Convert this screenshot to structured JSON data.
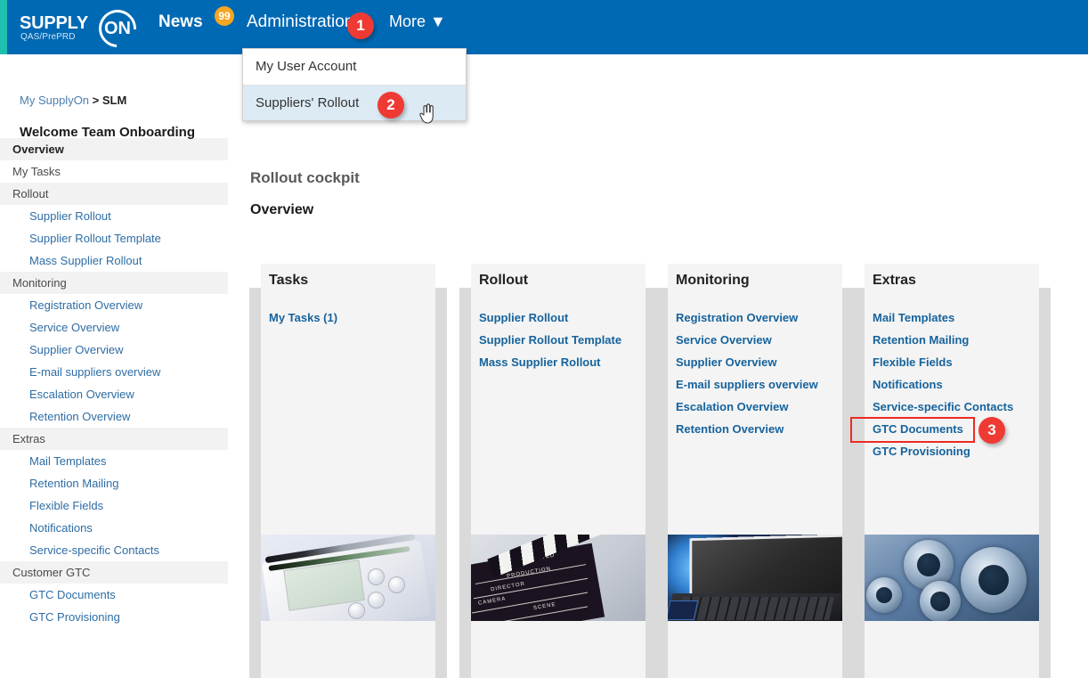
{
  "header": {
    "logo": {
      "word": "SUPPLY",
      "on": "ON",
      "sub": "QAS/PrePRD",
      "brand_color": "#0069b4",
      "accent_color": "#1ec0b0"
    },
    "nav": {
      "news_label": "News",
      "news_badge": "99",
      "news_badge_color": "#f5a623",
      "admin_label": "Administration",
      "more_label": "More ▼"
    }
  },
  "dropdown": {
    "items": [
      {
        "label": "My User Account",
        "active": false
      },
      {
        "label": "Suppliers' Rollout",
        "active": true
      }
    ]
  },
  "annotations": {
    "badge_color": "#ef3a34",
    "highlight_color": "#ee2a22",
    "steps": [
      {
        "number": "1",
        "target": "Administration"
      },
      {
        "number": "2",
        "target": "Suppliers' Rollout"
      },
      {
        "number": "3",
        "target": "GTC Documents"
      }
    ]
  },
  "breadcrumb": {
    "root": "My SupplyOn",
    "separator": ">",
    "current": "SLM"
  },
  "welcome": "Welcome Team Onboarding",
  "sidebar": {
    "items": [
      {
        "type": "group",
        "label": "Overview",
        "bold": true
      },
      {
        "type": "plain",
        "label": "My Tasks"
      },
      {
        "type": "group",
        "label": "Rollout",
        "bold": false
      },
      {
        "type": "link",
        "label": "Supplier Rollout"
      },
      {
        "type": "link",
        "label": "Supplier Rollout Template"
      },
      {
        "type": "link",
        "label": "Mass Supplier Rollout"
      },
      {
        "type": "group",
        "label": "Monitoring",
        "bold": false
      },
      {
        "type": "link",
        "label": "Registration Overview"
      },
      {
        "type": "link",
        "label": "Service Overview"
      },
      {
        "type": "link",
        "label": "Supplier Overview"
      },
      {
        "type": "link",
        "label": "E-mail suppliers overview"
      },
      {
        "type": "link",
        "label": "Escalation Overview"
      },
      {
        "type": "link",
        "label": "Retention Overview"
      },
      {
        "type": "group",
        "label": "Extras",
        "bold": false
      },
      {
        "type": "link",
        "label": "Mail Templates"
      },
      {
        "type": "link",
        "label": "Retention Mailing"
      },
      {
        "type": "link",
        "label": "Flexible Fields"
      },
      {
        "type": "link",
        "label": "Notifications"
      },
      {
        "type": "link",
        "label": "Service-specific Contacts"
      },
      {
        "type": "group",
        "label": "Customer GTC",
        "bold": false
      },
      {
        "type": "link",
        "label": "GTC Documents"
      },
      {
        "type": "link",
        "label": "GTC Provisioning"
      }
    ]
  },
  "main": {
    "title": "Rollout cockpit",
    "subtitle": "Overview",
    "cards": [
      {
        "heading": "Tasks",
        "photo": "pda-organizer-photo",
        "links": [
          "My Tasks (1)"
        ]
      },
      {
        "heading": "Rollout",
        "photo": "clapperboard-photo",
        "links": [
          "Supplier Rollout",
          "Supplier Rollout Template",
          "Mass Supplier Rollout"
        ]
      },
      {
        "heading": "Monitoring",
        "photo": "laptop-photo",
        "links": [
          "Registration Overview",
          "Service Overview",
          "Supplier Overview",
          "E-mail suppliers overview",
          "Escalation Overview",
          "Retention Overview"
        ]
      },
      {
        "heading": "Extras",
        "photo": "gears-photo",
        "links": [
          "Mail Templates",
          "Retention Mailing",
          "Flexible Fields",
          "Notifications",
          "Service-specific Contacts",
          "GTC Documents",
          "GTC Provisioning"
        ]
      }
    ]
  },
  "clapperboard_text": {
    "l1": "DIRECTED",
    "l2": "PRODUCTION",
    "l3": "DIRECTOR",
    "l4": "CAMERA",
    "l5": "SCENE"
  }
}
